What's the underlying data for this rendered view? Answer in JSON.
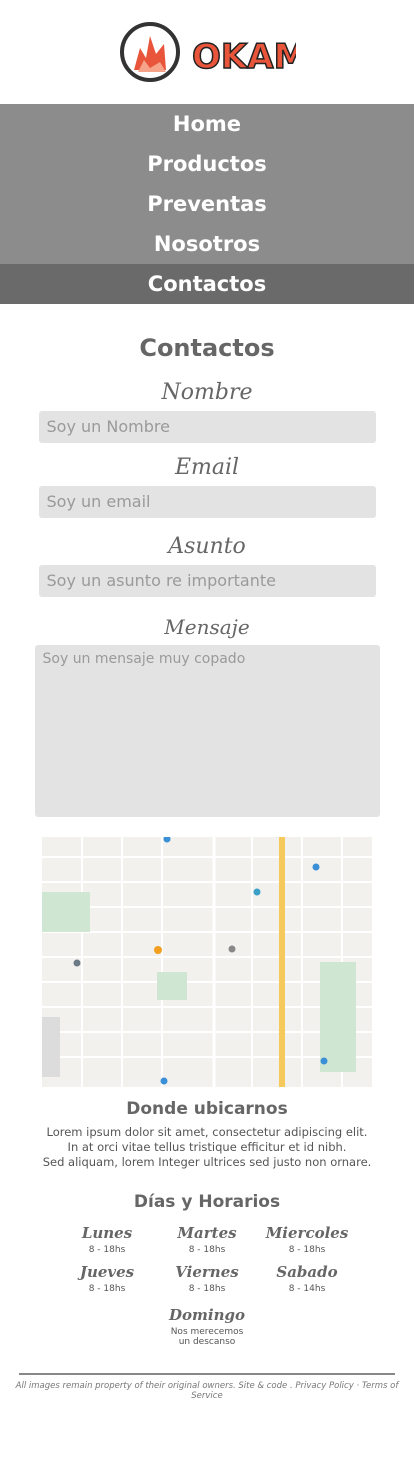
{
  "brand": {
    "name": "OKAMI",
    "accent": "#e8553a"
  },
  "nav": {
    "items": [
      {
        "label": "Home"
      },
      {
        "label": "Productos"
      },
      {
        "label": "Preventas"
      },
      {
        "label": "Nosotros"
      },
      {
        "label": "Contactos",
        "active": true
      }
    ]
  },
  "form": {
    "title": "Contactos",
    "nombre_label": "Nombre",
    "nombre_placeholder": "Soy un Nombre",
    "email_label": "Email",
    "email_placeholder": "Soy un email",
    "asunto_label": "Asunto",
    "asunto_placeholder": "Soy un asunto re importante",
    "mensaje_label": "Mensaje",
    "mensaje_placeholder": "Soy un mensaje muy copado"
  },
  "location": {
    "title": "Donde ubicarnos",
    "text1": "Lorem ipsum dolor sit amet, consectetur adipiscing elit. In at orci vitae tellus tristique efficitur et id nibh.",
    "text2": "Sed aliquam, lorem Integer ultrices sed justo non ornare."
  },
  "hours": {
    "title": "Días y Horarios",
    "days": [
      {
        "name": "Lunes",
        "hours": "8 - 18hs"
      },
      {
        "name": "Martes",
        "hours": "8 - 18hs"
      },
      {
        "name": "Miercoles",
        "hours": "8 - 18hs"
      },
      {
        "name": "Jueves",
        "hours": "8 - 18hs"
      },
      {
        "name": "Viernes",
        "hours": "8 - 18hs"
      },
      {
        "name": "Sabado",
        "hours": "8 - 14hs"
      }
    ],
    "sunday": {
      "name": "Domingo",
      "hours_line1": "Nos merecemos",
      "hours_line2": "un descanso"
    }
  },
  "footer": {
    "text": "All images remain property of their original owners. Site & code . Privacy Policy · Terms of Service"
  }
}
